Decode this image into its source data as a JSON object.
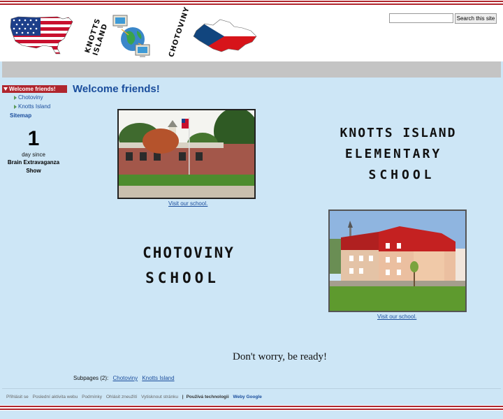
{
  "header": {
    "label_knotts": "KNOTTS ISLAND",
    "label_chotoviny": "CHOTOVINY"
  },
  "search": {
    "placeholder": "",
    "button_label": "Search this site"
  },
  "sidebar": {
    "active_label": "Welcome friends!",
    "sub_items": [
      "Chotoviny",
      "Knotts Island"
    ],
    "sitemap_label": "Sitemap"
  },
  "countdown": {
    "number": "1",
    "unit": "day since",
    "event": "Brain Extravaganza Show"
  },
  "main": {
    "title": "Welcome friends!",
    "knotts_logo_lines": [
      "KNOTTS ISLAND",
      "ELEMENTARY",
      "SCHOOL"
    ],
    "chotoviny_logo_lines": [
      "CHOTOVINY",
      "SCHOOL"
    ],
    "caption_knotts": "Visit our school.",
    "caption_chotoviny": "Visit our school.",
    "slogan": "Don't worry, be ready!",
    "subpages_label": "Subpages (2):",
    "subpages": [
      "Chotoviny",
      "Knotts Island"
    ]
  },
  "footer": {
    "links": [
      "Přihlásit se",
      "Poslední aktivita webu",
      "Podmínky",
      "Ohlásit zneužití",
      "Vytisknout stránku"
    ],
    "powered_prefix": "Používá technologii",
    "powered_brand": "Weby Google"
  },
  "colors": {
    "background": "#cde6f6",
    "accent_red": "#b0262e",
    "link_blue": "#1a4d9c",
    "band_gray": "#c4c4c4"
  }
}
